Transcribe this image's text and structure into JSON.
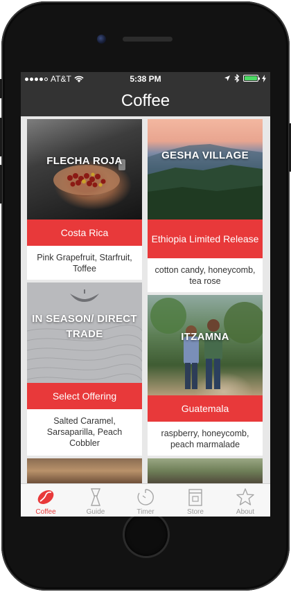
{
  "status_bar": {
    "carrier": "AT&T",
    "time": "5:38 PM"
  },
  "nav": {
    "title": "Coffee"
  },
  "cards": [
    {
      "title": "FLECHA ROJA",
      "origin": "Costa Rica",
      "notes": "Pink Grapefruit, Starfruit, Toffee"
    },
    {
      "title": "GESHA VILLAGE",
      "origin": "Ethiopia Limited Release",
      "notes": "cotton candy, honeycomb, tea rose"
    },
    {
      "title": "IN SEASON/ DIRECT TRADE",
      "origin": "Select Offering",
      "notes": "Salted Caramel, Sarsaparilla, Peach Cobbler"
    },
    {
      "title": "ITZAMNA",
      "origin": "Guatemala",
      "notes": "raspberry, honeycomb, peach marmalade"
    }
  ],
  "tabs": [
    {
      "label": "Coffee",
      "icon": "coffee-bean-icon",
      "active": true
    },
    {
      "label": "Guide",
      "icon": "chemex-icon",
      "active": false
    },
    {
      "label": "Timer",
      "icon": "timer-icon",
      "active": false
    },
    {
      "label": "Store",
      "icon": "store-bag-icon",
      "active": false
    },
    {
      "label": "About",
      "icon": "star-icon",
      "active": false
    }
  ],
  "colors": {
    "accent": "#e8393a",
    "bar": "#333333",
    "battery": "#4cd964"
  }
}
